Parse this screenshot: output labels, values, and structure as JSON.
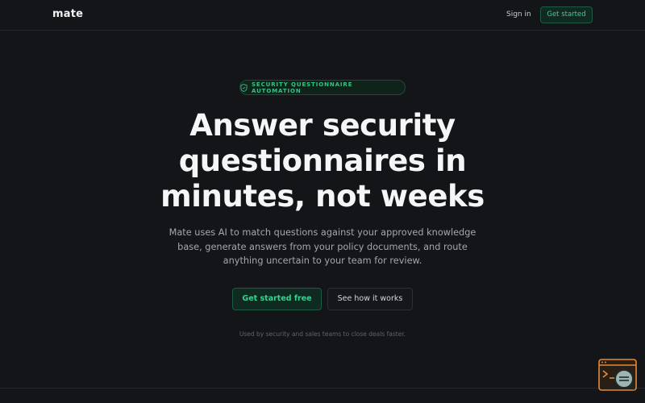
{
  "nav": {
    "logo": "mate",
    "sign_in": "Sign in",
    "cta": "Get started"
  },
  "badge": {
    "icon": "shield-icon",
    "label": "SECURITY QUESTIONNAIRE AUTOMATION"
  },
  "hero": {
    "headline_line1": "Answer security",
    "headline_line2": "questionnaires in",
    "headline_line3": "minutes, not weeks",
    "subtitle_line1": "Mate uses AI to match questions against your approved knowledge",
    "subtitle_line2": "base, generate answers from your policy documents, and route",
    "subtitle_line3": "anything uncertain to your team for review.",
    "primary_cta": "Get started free",
    "secondary_cta": "See how it works",
    "footnote": "Used by security and sales teams to close deals faster."
  },
  "colors": {
    "background": "#141518",
    "accent": "#3ccf91",
    "widget": "#e08a3c"
  },
  "widget": {
    "icon": "chat-widget-icon"
  }
}
